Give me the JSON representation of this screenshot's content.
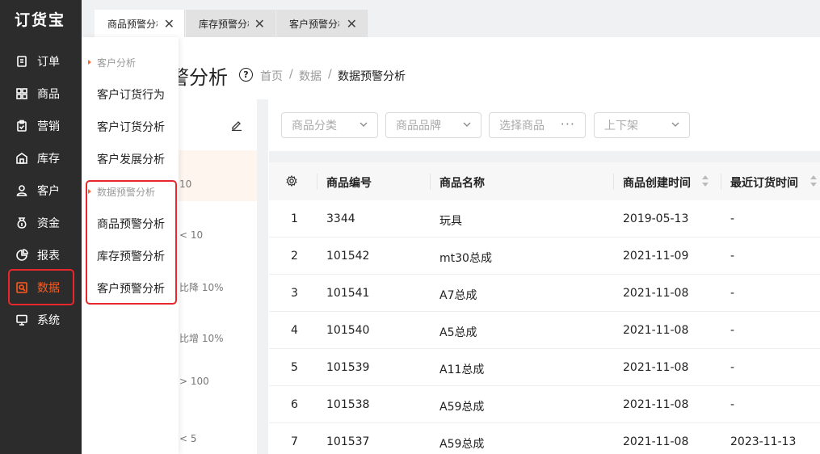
{
  "app": {
    "logo": "订货宝"
  },
  "sidebar": {
    "items": [
      {
        "label": "订单",
        "icon": "file-icon"
      },
      {
        "label": "商品",
        "icon": "grid-icon"
      },
      {
        "label": "营销",
        "icon": "clipboard-icon"
      },
      {
        "label": "库存",
        "icon": "warehouse-icon"
      },
      {
        "label": "客户",
        "icon": "user-icon"
      },
      {
        "label": "资金",
        "icon": "moneybag-icon"
      },
      {
        "label": "报表",
        "icon": "pie-chart-icon"
      },
      {
        "label": "数据",
        "icon": "data-search-icon",
        "active": true
      },
      {
        "label": "系统",
        "icon": "monitor-icon"
      }
    ],
    "active_color": "#ff5a1f"
  },
  "submenu": {
    "group1": "客户分析",
    "group1_items": [
      "客户订货行为",
      "客户订货分析",
      "客户发展分析"
    ],
    "group2": "数据预警分析",
    "group2_items": [
      "商品预警分析",
      "库存预警分析",
      "客户预警分析"
    ]
  },
  "tabs": [
    {
      "label": "商品预警分析"
    },
    {
      "label": "库存预警分析"
    },
    {
      "label": "客户预警分析"
    }
  ],
  "page": {
    "title": "警分析",
    "breadcrumb": [
      "首页",
      "数据",
      "数据预警分析"
    ]
  },
  "rules": [
    "10",
    "< 10",
    "比降 10%",
    "比增 10%",
    "> 100",
    "< 5"
  ],
  "filters": [
    {
      "placeholder": "商品分类"
    },
    {
      "placeholder": "商品品牌"
    },
    {
      "placeholder": "选择商品"
    },
    {
      "placeholder": "上下架"
    }
  ],
  "table": {
    "columns": [
      "商品编号",
      "商品名称",
      "商品创建时间",
      "最近订货时间"
    ],
    "rows": [
      {
        "no": "1",
        "code": "3344",
        "name": "玩具",
        "created": "2019-05-13",
        "last": "-"
      },
      {
        "no": "2",
        "code": "101542",
        "name": "mt30总成",
        "created": "2021-11-09",
        "last": "-"
      },
      {
        "no": "3",
        "code": "101541",
        "name": "A7总成",
        "created": "2021-11-08",
        "last": "-"
      },
      {
        "no": "4",
        "code": "101540",
        "name": "A5总成",
        "created": "2021-11-08",
        "last": "-"
      },
      {
        "no": "5",
        "code": "101539",
        "name": "A11总成",
        "created": "2021-11-08",
        "last": "-"
      },
      {
        "no": "6",
        "code": "101538",
        "name": "A59总成",
        "created": "2021-11-08",
        "last": "-"
      },
      {
        "no": "7",
        "code": "101537",
        "name": "A59总成",
        "created": "2021-11-08",
        "last": "2023-11-13"
      }
    ]
  }
}
